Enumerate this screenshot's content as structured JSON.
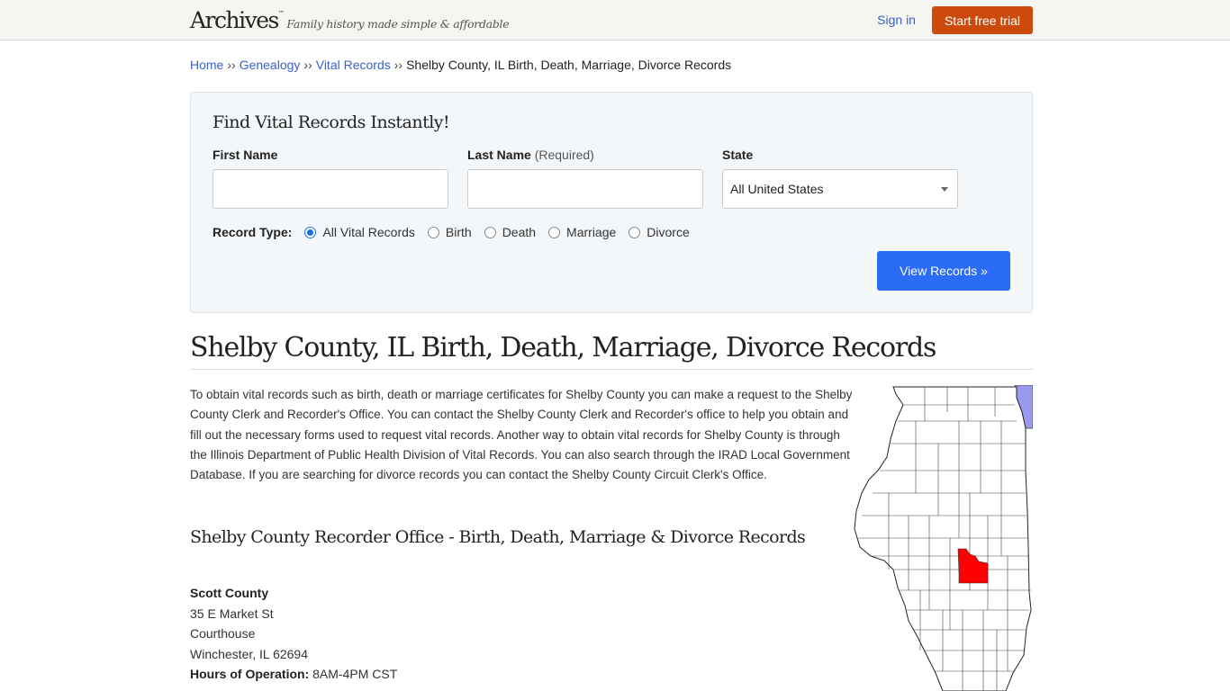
{
  "header": {
    "logo": "Archives",
    "logo_tm": "™",
    "tagline": "Family history made simple & affordable",
    "signin_label": "Sign in",
    "trial_label": "Start free trial",
    "trial_color": "#cc4b0c"
  },
  "breadcrumb": {
    "items": [
      "Home",
      "Genealogy",
      "Vital Records"
    ],
    "separator": "››",
    "current": "Shelby County, IL Birth, Death, Marriage, Divorce Records"
  },
  "search": {
    "title": "Find Vital Records Instantly!",
    "first_name_label": "First Name",
    "first_name_value": "",
    "last_name_label": "Last Name",
    "last_name_hint": "(Required)",
    "last_name_value": "",
    "state_label": "State",
    "state_value": "All United States",
    "record_type_label": "Record Type:",
    "record_types": [
      "All Vital Records",
      "Birth",
      "Death",
      "Marriage",
      "Divorce"
    ],
    "record_type_selected": "All Vital Records",
    "submit_label": "View Records »",
    "submit_color": "#2a6cf6"
  },
  "page": {
    "title": "Shelby County, IL Birth, Death, Marriage, Divorce Records",
    "intro": "To obtain vital records such as birth, death or marriage certificates for Shelby County you can make a request to the Shelby County Clerk and Recorder's Office. You can contact the Shelby County Clerk and Recorder's office to help you obtain and fill out the necessary forms used to request vital records. Another way to obtain vital records for Shelby County is through the Illinois Department of Public Health Division of Vital Records. You can also search through the IRAD Local Government Database. If you are searching for divorce records you can contact the Shelby County Circuit Clerk's Office.",
    "subtitle": "Shelby County Recorder Office - Birth, Death, Marriage & Divorce Records"
  },
  "office": {
    "name": "Scott County",
    "address_line1": "35 E Market St",
    "address_line2": "Courthouse",
    "city_line": "Winchester, IL 62694",
    "hours_label": "Hours of Operation:",
    "hours_value": "8AM-4PM CST"
  },
  "map": {
    "state": "Illinois",
    "highlighted_county": "Shelby County",
    "highlight_color": "#ff0000",
    "lake_color": "#9999ee"
  }
}
